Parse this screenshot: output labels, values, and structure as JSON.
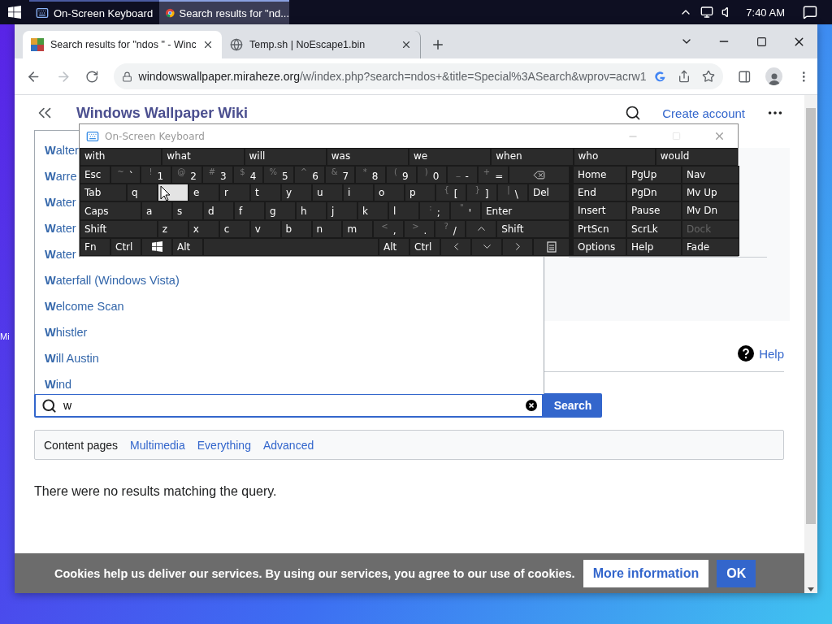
{
  "taskbar": {
    "buttons": [
      {
        "label": "On-Screen Keyboard",
        "kind": "keyboard",
        "selected": false
      },
      {
        "label": "Search results for \"nd...",
        "kind": "chrome",
        "selected": true
      }
    ],
    "clock": "7:40 AM"
  },
  "desktop_labels": [
    "Mi"
  ],
  "browser": {
    "tabs": [
      {
        "title": "Search results for \"ndos \" - Winc",
        "kind": "wiki",
        "selected": true
      },
      {
        "title": "Temp.sh | NoEscape1.bin",
        "kind": "globe",
        "selected": false
      }
    ],
    "url": {
      "host": "windowswallpaper.miraheze.org",
      "path": "/w/index.php?search=ndos+&title=Special%3ASearch&wprov=acrw1"
    }
  },
  "page": {
    "site_title": "Windows Wallpaper Wiki",
    "create_account": "Create account",
    "help": "Help",
    "search": {
      "value": "w",
      "button": "Search"
    },
    "suggestions": [
      "**W**alter",
      "**W**arre",
      "**W**ater",
      "**W**ater",
      "**W**ater",
      "**W**aterfall (Windows Vista)",
      "**W**elcome Scan",
      "**W**histler",
      "**W**ill Austin",
      "**W**ind"
    ],
    "filters": [
      {
        "label": "Content pages",
        "selected": true
      },
      {
        "label": "Multimedia",
        "selected": false
      },
      {
        "label": "Everything",
        "selected": false
      },
      {
        "label": "Advanced",
        "selected": false
      }
    ],
    "message": "There were no results matching the query."
  },
  "cookie_bar": {
    "text": "Cookies help us deliver our services. By using our services, you agree to our use of cookies.",
    "more": "More information",
    "ok": "OK"
  },
  "keyboard": {
    "title": "On-Screen Keyboard",
    "predictions": [
      "with",
      "what",
      "will",
      "was",
      "we",
      "when",
      "who",
      "would"
    ],
    "rows": [
      [
        {
          "kind": "char",
          "label": "Esc",
          "pressed": false
        },
        {
          "kind": "char",
          "label": "`",
          "shift": "~",
          "pressed": false
        },
        {
          "kind": "char",
          "label": "1",
          "shift": "!",
          "pressed": false
        },
        {
          "kind": "char",
          "label": "2",
          "shift": "@",
          "pressed": false
        },
        {
          "kind": "char",
          "label": "3",
          "shift": "#",
          "pressed": false
        },
        {
          "kind": "char",
          "label": "4",
          "shift": "$",
          "pressed": false
        },
        {
          "kind": "char",
          "label": "5",
          "shift": "%",
          "pressed": false
        },
        {
          "kind": "char",
          "label": "6",
          "shift": "^",
          "pressed": false
        },
        {
          "kind": "char",
          "label": "7",
          "shift": "&",
          "pressed": false
        },
        {
          "kind": "char",
          "label": "8",
          "shift": "*",
          "pressed": false
        },
        {
          "kind": "char",
          "label": "9",
          "shift": "(",
          "pressed": false
        },
        {
          "kind": "char",
          "label": "0",
          "shift": ")",
          "pressed": false
        },
        {
          "kind": "char",
          "label": "-",
          "shift": "_",
          "pressed": false
        },
        {
          "kind": "char",
          "label": "=",
          "shift": "+",
          "pressed": false
        },
        {
          "kind": "backspace",
          "pressed": false
        }
      ],
      [
        {
          "kind": "tab",
          "label": "Tab",
          "pressed": false
        },
        {
          "kind": "char",
          "label": "q",
          "pressed": false
        },
        {
          "kind": "char",
          "pressed": true
        },
        {
          "kind": "char",
          "label": "e",
          "pressed": false
        },
        {
          "kind": "char",
          "label": "r",
          "pressed": false
        },
        {
          "kind": "char",
          "label": "t",
          "pressed": false
        },
        {
          "kind": "char",
          "label": "y",
          "pressed": false
        },
        {
          "kind": "char",
          "label": "u",
          "pressed": false
        },
        {
          "kind": "char",
          "label": "i",
          "pressed": false
        },
        {
          "kind": "char",
          "label": "o",
          "pressed": false
        },
        {
          "kind": "char",
          "label": "p",
          "pressed": false
        },
        {
          "kind": "char",
          "label": "[",
          "shift": "{",
          "pressed": false
        },
        {
          "kind": "char",
          "label": "]",
          "shift": "}",
          "pressed": false
        },
        {
          "kind": "char",
          "label": "\\",
          "shift": "|",
          "pressed": false
        },
        {
          "kind": "del",
          "label": "Del",
          "pressed": false
        }
      ],
      [
        {
          "kind": "caps",
          "label": "Caps",
          "pressed": false
        },
        {
          "kind": "char",
          "label": "a",
          "pressed": false
        },
        {
          "kind": "char",
          "label": "s",
          "pressed": false
        },
        {
          "kind": "char",
          "label": "d",
          "pressed": false
        },
        {
          "kind": "char",
          "label": "f",
          "pressed": false
        },
        {
          "kind": "char",
          "label": "g",
          "pressed": false
        },
        {
          "kind": "char",
          "label": "h",
          "pressed": false
        },
        {
          "kind": "char",
          "label": "j",
          "pressed": false
        },
        {
          "kind": "char",
          "label": "k",
          "pressed": false
        },
        {
          "kind": "char",
          "label": "l",
          "pressed": false
        },
        {
          "kind": "char",
          "label": ";",
          "shift": ":",
          "pressed": false
        },
        {
          "kind": "char",
          "label": "'",
          "shift": "\"",
          "pressed": false
        },
        {
          "kind": "enter",
          "label": "Enter",
          "pressed": false
        }
      ],
      [
        {
          "kind": "shift",
          "label": "Shift",
          "pressed": false
        },
        {
          "kind": "char",
          "label": "z",
          "pressed": false
        },
        {
          "kind": "char",
          "label": "x",
          "pressed": false
        },
        {
          "kind": "char",
          "label": "c",
          "pressed": false
        },
        {
          "kind": "char",
          "label": "v",
          "pressed": false
        },
        {
          "kind": "char",
          "label": "b",
          "pressed": false
        },
        {
          "kind": "char",
          "label": "n",
          "pressed": false
        },
        {
          "kind": "char",
          "label": "m",
          "pressed": false
        },
        {
          "kind": "char",
          "label": ",",
          "shift": "<",
          "pressed": false
        },
        {
          "kind": "char",
          "label": ".",
          "shift": ">",
          "pressed": false
        },
        {
          "kind": "char",
          "label": "/",
          "shift": "?",
          "pressed": false
        },
        {
          "kind": "up",
          "pressed": false
        },
        {
          "kind": "rshift",
          "label": "Shift",
          "pressed": false
        }
      ],
      [
        {
          "kind": "char",
          "label": "Fn",
          "pressed": false
        },
        {
          "kind": "char",
          "label": "Ctrl",
          "pressed": false
        },
        {
          "kind": "win",
          "pressed": false
        },
        {
          "kind": "char",
          "label": "Alt",
          "pressed": false
        },
        {
          "kind": "space",
          "pressed": false
        },
        {
          "kind": "char",
          "label": "Alt",
          "pressed": false
        },
        {
          "kind": "char",
          "label": "Ctrl",
          "pressed": false
        },
        {
          "kind": "left",
          "pressed": false
        },
        {
          "kind": "down",
          "pressed": false
        },
        {
          "kind": "right",
          "pressed": false
        },
        {
          "kind": "menu",
          "pressed": false
        }
      ]
    ],
    "nav_keys": [
      {
        "label": "Home",
        "disabled": false
      },
      {
        "label": "PgUp",
        "disabled": false
      },
      {
        "label": "Nav",
        "disabled": false
      },
      {
        "label": "End",
        "disabled": false
      },
      {
        "label": "PgDn",
        "disabled": false
      },
      {
        "label": "Mv Up",
        "disabled": false
      },
      {
        "label": "Insert",
        "disabled": false
      },
      {
        "label": "Pause",
        "disabled": false
      },
      {
        "label": "Mv Dn",
        "disabled": false
      },
      {
        "label": "PrtScn",
        "disabled": false
      },
      {
        "label": "ScrLk",
        "disabled": false
      },
      {
        "label": "Dock",
        "disabled": true
      },
      {
        "label": "Options",
        "disabled": false
      },
      {
        "label": "Help",
        "disabled": false
      },
      {
        "label": "Fade",
        "disabled": false
      }
    ]
  }
}
